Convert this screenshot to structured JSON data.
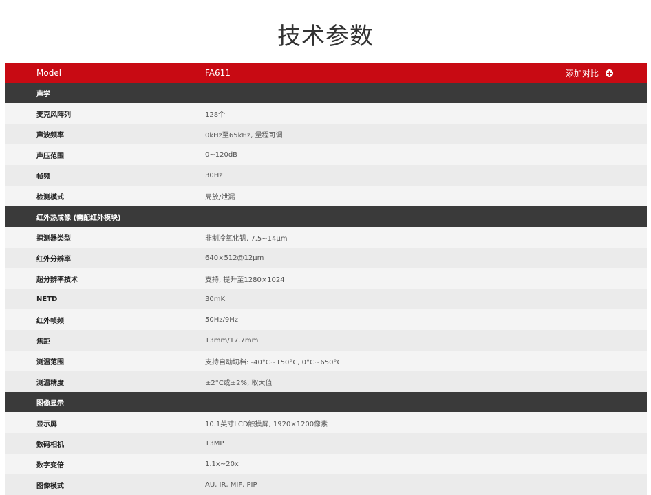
{
  "page_title": "技术参数",
  "header": {
    "model_label": "Model",
    "model_value": "FA611",
    "add_compare_label": "添加对比",
    "add_icon": "plus-circle-icon"
  },
  "sections": [
    {
      "title": "声学",
      "rows": [
        {
          "key": "麦克风阵列",
          "value": "128个"
        },
        {
          "key": "声波频率",
          "value": "0kHz至65kHz, 量程可调"
        },
        {
          "key": "声压范围",
          "value": "0~120dB"
        },
        {
          "key": "帧频",
          "value": "30Hz"
        },
        {
          "key": "检测模式",
          "value": "局放/泄漏"
        }
      ]
    },
    {
      "title": "红外热成像 (需配红外模块)",
      "rows": [
        {
          "key": "探测器类型",
          "value": "非制冷氧化钒, 7.5~14μm"
        },
        {
          "key": "红外分辨率",
          "value": "640×512@12μm"
        },
        {
          "key": "超分辨率技术",
          "value": "支持, 提升至1280×1024"
        },
        {
          "key": "NETD",
          "value": "30mK"
        },
        {
          "key": "红外帧频",
          "value": "50Hz/9Hz"
        },
        {
          "key": "焦距",
          "value": "13mm/17.7mm"
        },
        {
          "key": "测温范围",
          "value": "支持自动切档: -40°C~150°C, 0°C~650°C"
        },
        {
          "key": "测温精度",
          "value": "±2°C或±2%, 取大值"
        }
      ]
    },
    {
      "title": "图像显示",
      "rows": [
        {
          "key": "显示屏",
          "value": "10.1英寸LCD触摸屏, 1920×1200像素"
        },
        {
          "key": "数码相机",
          "value": "13MP"
        },
        {
          "key": "数字变倍",
          "value": "1.1x~20x"
        },
        {
          "key": "图像模式",
          "value": "AU, IR, MIF, PIP"
        }
      ]
    }
  ],
  "colors": {
    "header_bg": "#c80a13",
    "section_bg": "#3a3a3a",
    "row_light": "#f4f4f4",
    "row_dark": "#ebebeb"
  }
}
